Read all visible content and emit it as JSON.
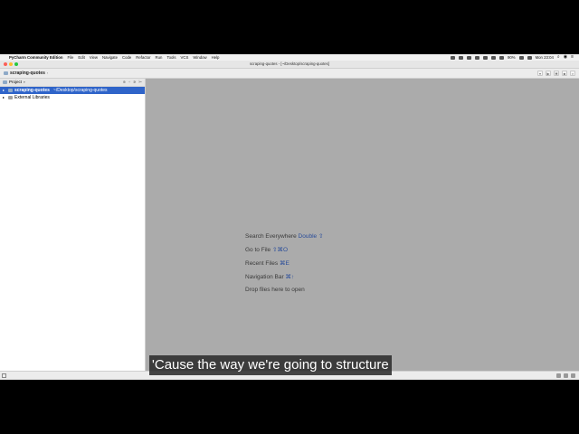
{
  "menubar": {
    "app_name": "PyCharm Community Edition",
    "items": [
      "File",
      "Edit",
      "View",
      "Navigate",
      "Code",
      "Refactor",
      "Run",
      "Tools",
      "VCS",
      "Window",
      "Help"
    ],
    "battery": "90%",
    "clock": "Mon 23:04"
  },
  "window": {
    "title": "scraping-quotes - [~/Desktop/scraping-quotes]"
  },
  "navbar": {
    "breadcrumb": "scraping-quotes"
  },
  "project_panel": {
    "title": "Project",
    "tree": [
      {
        "name": "scraping-quotes",
        "path": "~/Desktop/scraping-quotes",
        "selected": true
      },
      {
        "name": "External Libraries",
        "path": "",
        "selected": false
      }
    ]
  },
  "editor": {
    "hints": [
      {
        "label": "Search Everywhere",
        "shortcut": "Double ⇧"
      },
      {
        "label": "Go to File",
        "shortcut": "⇧⌘O"
      },
      {
        "label": "Recent Files",
        "shortcut": "⌘E"
      },
      {
        "label": "Navigation Bar",
        "shortcut": "⌘↑"
      },
      {
        "label": "Drop files here to open",
        "shortcut": ""
      }
    ]
  },
  "subtitle": "'Cause the way we're going to structure",
  "colors": {
    "selection": "#2f64c9",
    "editor_bg": "#ababab",
    "shortcut": "#2a4d9a"
  }
}
